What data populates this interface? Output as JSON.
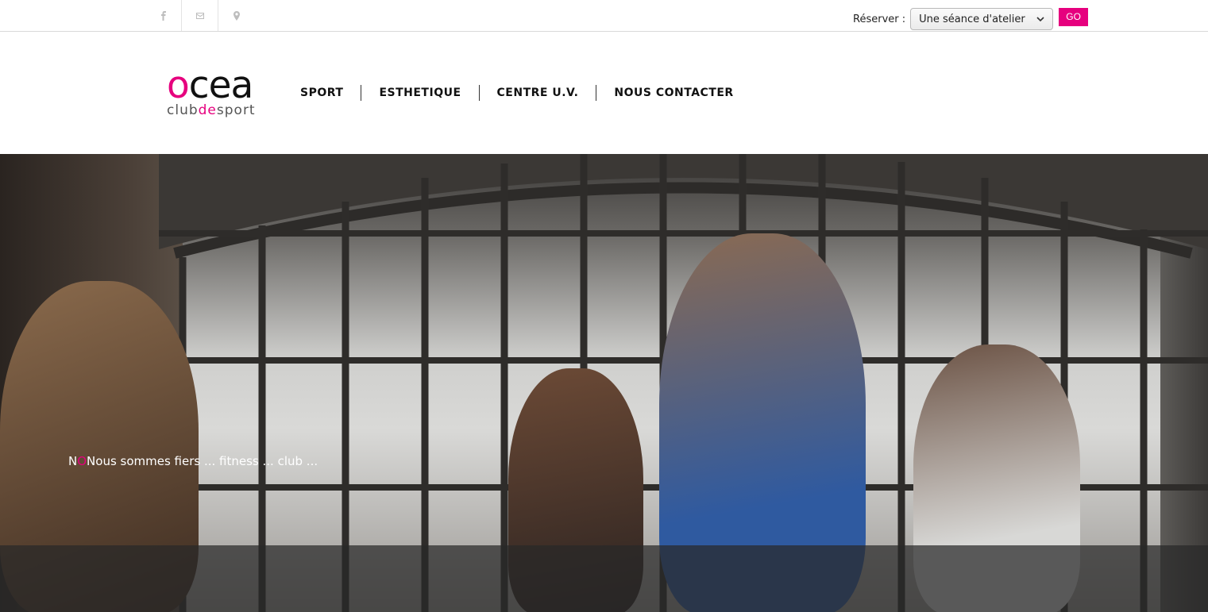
{
  "social": [
    {
      "name": "facebook-icon"
    },
    {
      "name": "email-icon"
    },
    {
      "name": "location-icon"
    }
  ],
  "reserve": {
    "label": "Réserver :",
    "selected": "Une séance d'atelier",
    "go_label": "GO"
  },
  "logo": {
    "main_prefix": "o",
    "main_rest": "cea",
    "sub_pre": "club",
    "sub_de": "de",
    "sub_post": "sport"
  },
  "nav": {
    "items": [
      "SPORT",
      "ESTHETIQUE",
      "CENTRE U.V.",
      "NOUS CONTACTER"
    ]
  },
  "colors": {
    "accent": "#e6007e"
  },
  "hero": {
    "caption_start": "N",
    "caption_brand": "O",
    "caption_rest": "Nous sommes fiers ... fitness ... club ..."
  }
}
